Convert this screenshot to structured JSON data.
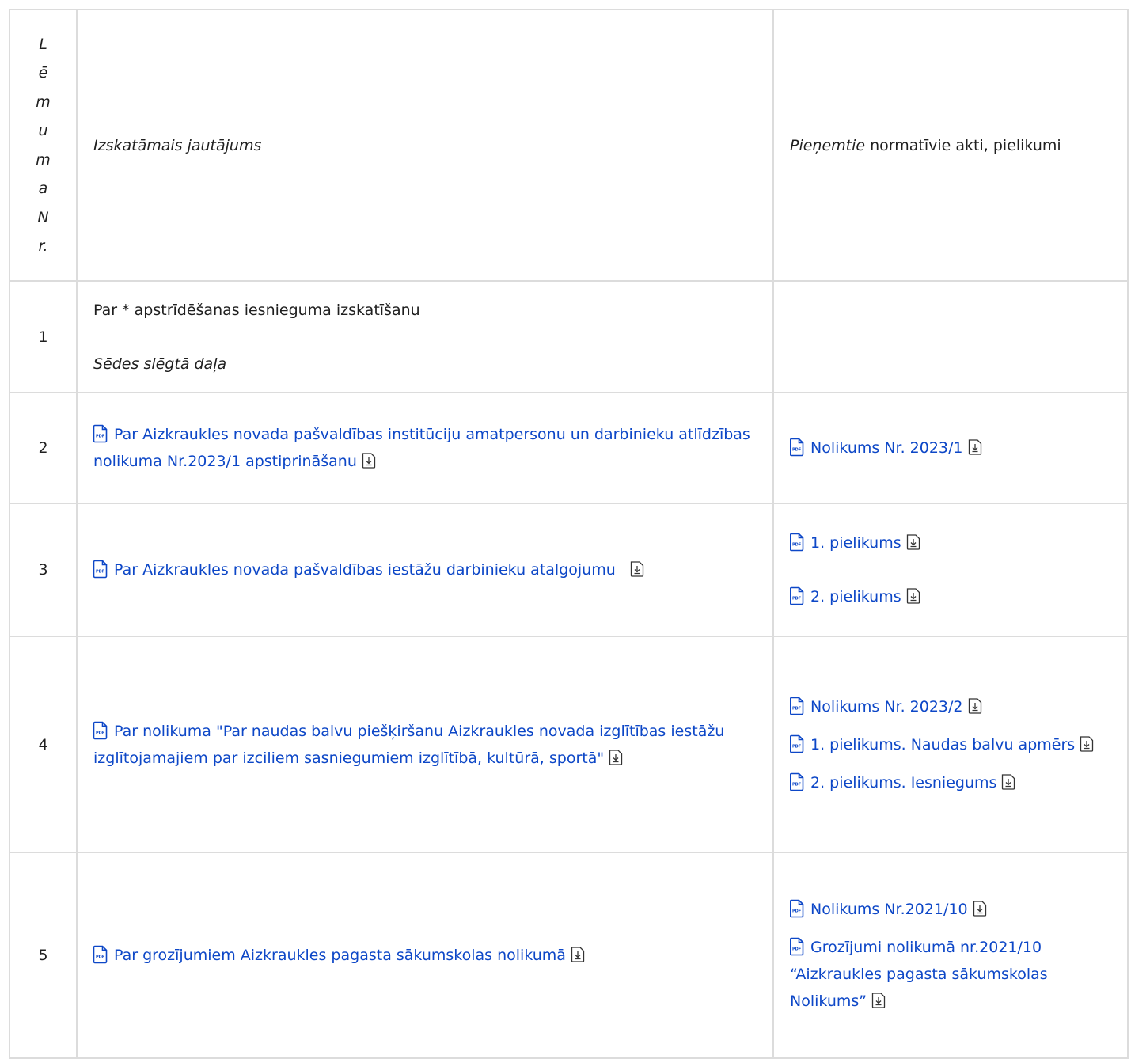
{
  "header": {
    "nr_letters": [
      "L",
      "ē",
      "m",
      "u",
      "m",
      "a",
      "N",
      "r."
    ],
    "issue": "Izskatāmais jautājums",
    "acts_italic": "Pieņemtie",
    "acts_rest": " normatīvie akti, pielikumi"
  },
  "rows": [
    {
      "nr": "1",
      "issue_text": "Par * apstrīdēšanas iesnieguma izskatīšanu",
      "issue_note": "Sēdes slēgtā daļa"
    },
    {
      "nr": "2",
      "issue_link": "Par Aizkraukles novada pašvaldības institūciju amatpersonu un darbinieku atlīdzības nolikuma Nr.2023/1 apstiprināšanu",
      "acts": [
        "Nolikums Nr. 2023/1"
      ]
    },
    {
      "nr": "3",
      "issue_link": "Par Aizkraukles novada pašvaldības iestāžu darbinieku atalgojumu",
      "acts": [
        "1. pielikums",
        "2. pielikums"
      ]
    },
    {
      "nr": "4",
      "issue_link": "Par nolikuma \"Par naudas balvu piešķiršanu Aizkraukles novada izglītības iestāžu izglītojamajiem par izciliem sasniegumiem izglītībā, kultūrā, sportā\"",
      "acts": [
        "Nolikums Nr. 2023/2",
        "1. pielikums. Naudas balvu apmērs",
        "2. pielikums. Iesniegums"
      ]
    },
    {
      "nr": "5",
      "issue_link": "Par grozījumiem Aizkraukles pagasta sākumskolas nolikumā",
      "acts": [
        "Nolikums Nr.2021/10",
        "Grozījumi nolikumā nr.2021/10 “Aizkraukles pagasta sākumskolas Nolikums”"
      ]
    }
  ],
  "colors": {
    "link": "#0d47c7",
    "border": "#dcdcdc",
    "text": "#1f1f1f"
  },
  "icons": {
    "file": "pdf-file-icon",
    "download": "download-icon"
  }
}
